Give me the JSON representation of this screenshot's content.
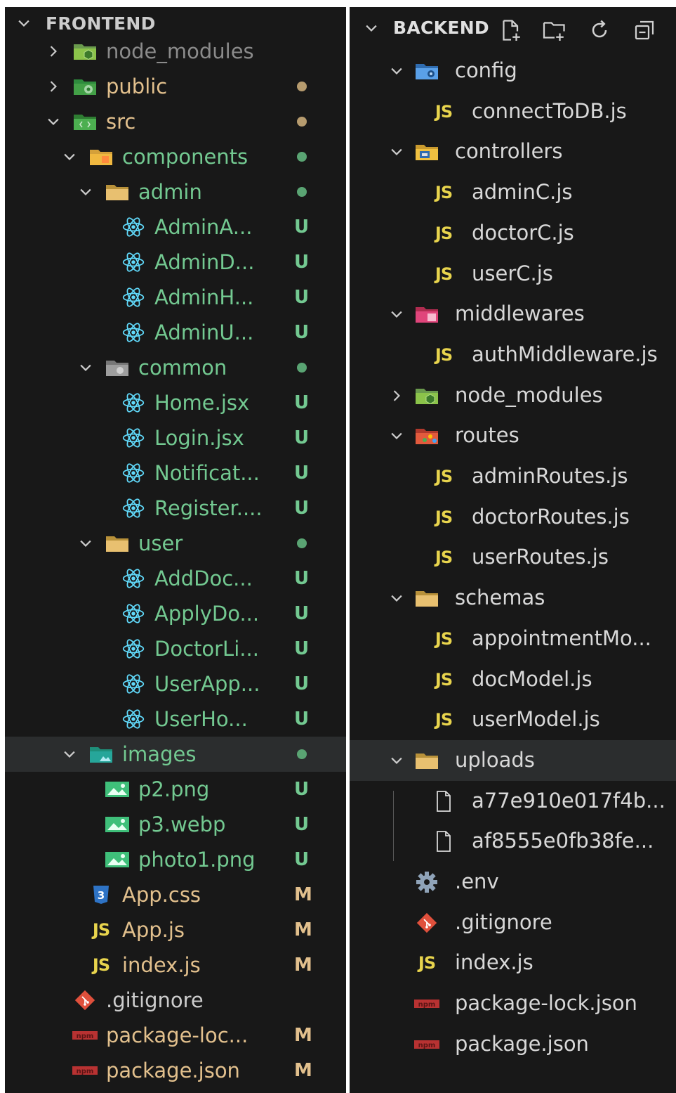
{
  "colors": {
    "background": "#181818",
    "tree_text": "#cccccc",
    "frontend_untracked": "#73c991",
    "frontend_folder_name": "#73c991",
    "frontend_modified": "#e2c08d",
    "frontend_dirty_folder": "#e2c08d",
    "badge_untracked": "#73c991",
    "badge_modified": "#e2c08d",
    "react": "#61dafb",
    "js": "#e8d44d",
    "selection": "#2b2d2e"
  },
  "frontend": {
    "title": "FRONTEND",
    "items": [
      {
        "label": "node_modules",
        "icon": "node-folder-icon",
        "depth": 1,
        "expanded": false,
        "color": "#8b8b8b",
        "badge": "",
        "dot": ""
      },
      {
        "label": "public",
        "icon": "public-folder-icon",
        "depth": 1,
        "expanded": false,
        "color": "#e2c08d",
        "badge": "",
        "dot": "#b69b6e"
      },
      {
        "label": "src",
        "icon": "src-folder-icon",
        "depth": 1,
        "expanded": true,
        "color": "#e2c08d",
        "badge": "",
        "dot": "#b69b6e"
      },
      {
        "label": "components",
        "icon": "components-folder-icon",
        "depth": 2,
        "expanded": true,
        "color": "#73c991",
        "badge": "",
        "dot": "#5aa473"
      },
      {
        "label": "admin",
        "icon": "folder-icon",
        "depth": 3,
        "expanded": true,
        "color": "#73c991",
        "badge": "",
        "dot": "#5aa473"
      },
      {
        "label": "AdminA...",
        "icon": "react-icon",
        "depth": 4,
        "color": "#73c991",
        "badge": "U",
        "dot": ""
      },
      {
        "label": "AdminD...",
        "icon": "react-icon",
        "depth": 4,
        "color": "#73c991",
        "badge": "U",
        "dot": ""
      },
      {
        "label": "AdminH...",
        "icon": "react-icon",
        "depth": 4,
        "color": "#73c991",
        "badge": "U",
        "dot": ""
      },
      {
        "label": "AdminU...",
        "icon": "react-icon",
        "depth": 4,
        "color": "#73c991",
        "badge": "U",
        "dot": ""
      },
      {
        "label": "common",
        "icon": "common-folder-icon",
        "depth": 3,
        "expanded": true,
        "color": "#73c991",
        "badge": "",
        "dot": "#5aa473"
      },
      {
        "label": "Home.jsx",
        "icon": "react-icon",
        "depth": 4,
        "color": "#73c991",
        "badge": "U",
        "dot": ""
      },
      {
        "label": "Login.jsx",
        "icon": "react-icon",
        "depth": 4,
        "color": "#73c991",
        "badge": "U",
        "dot": ""
      },
      {
        "label": "Notificat...",
        "icon": "react-icon",
        "depth": 4,
        "color": "#73c991",
        "badge": "U",
        "dot": ""
      },
      {
        "label": "Register....",
        "icon": "react-icon",
        "depth": 4,
        "color": "#73c991",
        "badge": "U",
        "dot": ""
      },
      {
        "label": "user",
        "icon": "folder-icon",
        "depth": 3,
        "expanded": true,
        "color": "#73c991",
        "badge": "",
        "dot": "#5aa473"
      },
      {
        "label": "AddDoc...",
        "icon": "react-icon",
        "depth": 4,
        "color": "#73c991",
        "badge": "U",
        "dot": ""
      },
      {
        "label": "ApplyDo...",
        "icon": "react-icon",
        "depth": 4,
        "color": "#73c991",
        "badge": "U",
        "dot": ""
      },
      {
        "label": "DoctorLi...",
        "icon": "react-icon",
        "depth": 4,
        "color": "#73c991",
        "badge": "U",
        "dot": ""
      },
      {
        "label": "UserApp...",
        "icon": "react-icon",
        "depth": 4,
        "color": "#73c991",
        "badge": "U",
        "dot": ""
      },
      {
        "label": "UserHo...",
        "icon": "react-icon",
        "depth": 4,
        "color": "#73c991",
        "badge": "U",
        "dot": ""
      },
      {
        "label": "images",
        "icon": "images-folder-icon",
        "depth": 2,
        "expanded": true,
        "color": "#73c991",
        "badge": "",
        "dot": "#5aa473",
        "selected": true
      },
      {
        "label": "p2.png",
        "icon": "image-icon",
        "depth": 3,
        "color": "#73c991",
        "badge": "U",
        "dot": ""
      },
      {
        "label": "p3.webp",
        "icon": "image-icon",
        "depth": 3,
        "color": "#73c991",
        "badge": "U",
        "dot": ""
      },
      {
        "label": "photo1.png",
        "icon": "image-icon",
        "depth": 3,
        "color": "#73c991",
        "badge": "U",
        "dot": ""
      },
      {
        "label": "App.css",
        "icon": "css-icon",
        "depth": 2,
        "color": "#e2c08d",
        "badge": "M",
        "dot": ""
      },
      {
        "label": "App.js",
        "icon": "js-icon",
        "depth": 2,
        "color": "#e2c08d",
        "badge": "M",
        "dot": ""
      },
      {
        "label": "index.js",
        "icon": "js-icon",
        "depth": 2,
        "color": "#e2c08d",
        "badge": "M",
        "dot": ""
      },
      {
        "label": ".gitignore",
        "icon": "git-icon",
        "depth": 1,
        "color": "#cccccc",
        "badge": "",
        "dot": ""
      },
      {
        "label": "package-loc...",
        "icon": "npm-icon",
        "depth": 1,
        "color": "#e2c08d",
        "badge": "M",
        "dot": ""
      },
      {
        "label": "package.json",
        "icon": "npm-icon",
        "depth": 1,
        "color": "#e2c08d",
        "badge": "M",
        "dot": ""
      }
    ]
  },
  "backend": {
    "title": "BACKEND",
    "toolbar": [
      "new-file-icon",
      "new-folder-icon",
      "refresh-icon",
      "collapse-all-icon"
    ],
    "items": [
      {
        "label": "config",
        "icon": "config-folder-icon",
        "depth": 1,
        "expanded": true
      },
      {
        "label": "connectToDB.js",
        "icon": "js-icon",
        "depth": 2
      },
      {
        "label": "controllers",
        "icon": "controllers-folder-icon",
        "depth": 1,
        "expanded": true
      },
      {
        "label": "adminC.js",
        "icon": "js-icon",
        "depth": 2
      },
      {
        "label": "doctorC.js",
        "icon": "js-icon",
        "depth": 2
      },
      {
        "label": "userC.js",
        "icon": "js-icon",
        "depth": 2
      },
      {
        "label": "middlewares",
        "icon": "middlewares-folder-icon",
        "depth": 1,
        "expanded": true
      },
      {
        "label": "authMiddleware.js",
        "icon": "js-icon",
        "depth": 2
      },
      {
        "label": "node_modules",
        "icon": "node-folder-icon",
        "depth": 1,
        "expanded": false
      },
      {
        "label": "routes",
        "icon": "routes-folder-icon",
        "depth": 1,
        "expanded": true
      },
      {
        "label": "adminRoutes.js",
        "icon": "js-icon",
        "depth": 2
      },
      {
        "label": "doctorRoutes.js",
        "icon": "js-icon",
        "depth": 2
      },
      {
        "label": "userRoutes.js",
        "icon": "js-icon",
        "depth": 2
      },
      {
        "label": "schemas",
        "icon": "folder-icon",
        "depth": 1,
        "expanded": true
      },
      {
        "label": "appointmentMo...",
        "icon": "js-icon",
        "depth": 2
      },
      {
        "label": "docModel.js",
        "icon": "js-icon",
        "depth": 2
      },
      {
        "label": "userModel.js",
        "icon": "js-icon",
        "depth": 2
      },
      {
        "label": "uploads",
        "icon": "folder-icon",
        "depth": 1,
        "expanded": true,
        "selected": true
      },
      {
        "label": "a77e910e017f4b...",
        "icon": "file-icon",
        "depth": 2
      },
      {
        "label": "af8555e0fb38fe...",
        "icon": "file-icon",
        "depth": 2
      },
      {
        "label": ".env",
        "icon": "gear-icon",
        "depth": 1
      },
      {
        "label": ".gitignore",
        "icon": "git-icon",
        "depth": 1
      },
      {
        "label": "index.js",
        "icon": "js-icon",
        "depth": 1
      },
      {
        "label": "package-lock.json",
        "icon": "npm-icon",
        "depth": 1
      },
      {
        "label": "package.json",
        "icon": "npm-icon",
        "depth": 1
      }
    ]
  }
}
